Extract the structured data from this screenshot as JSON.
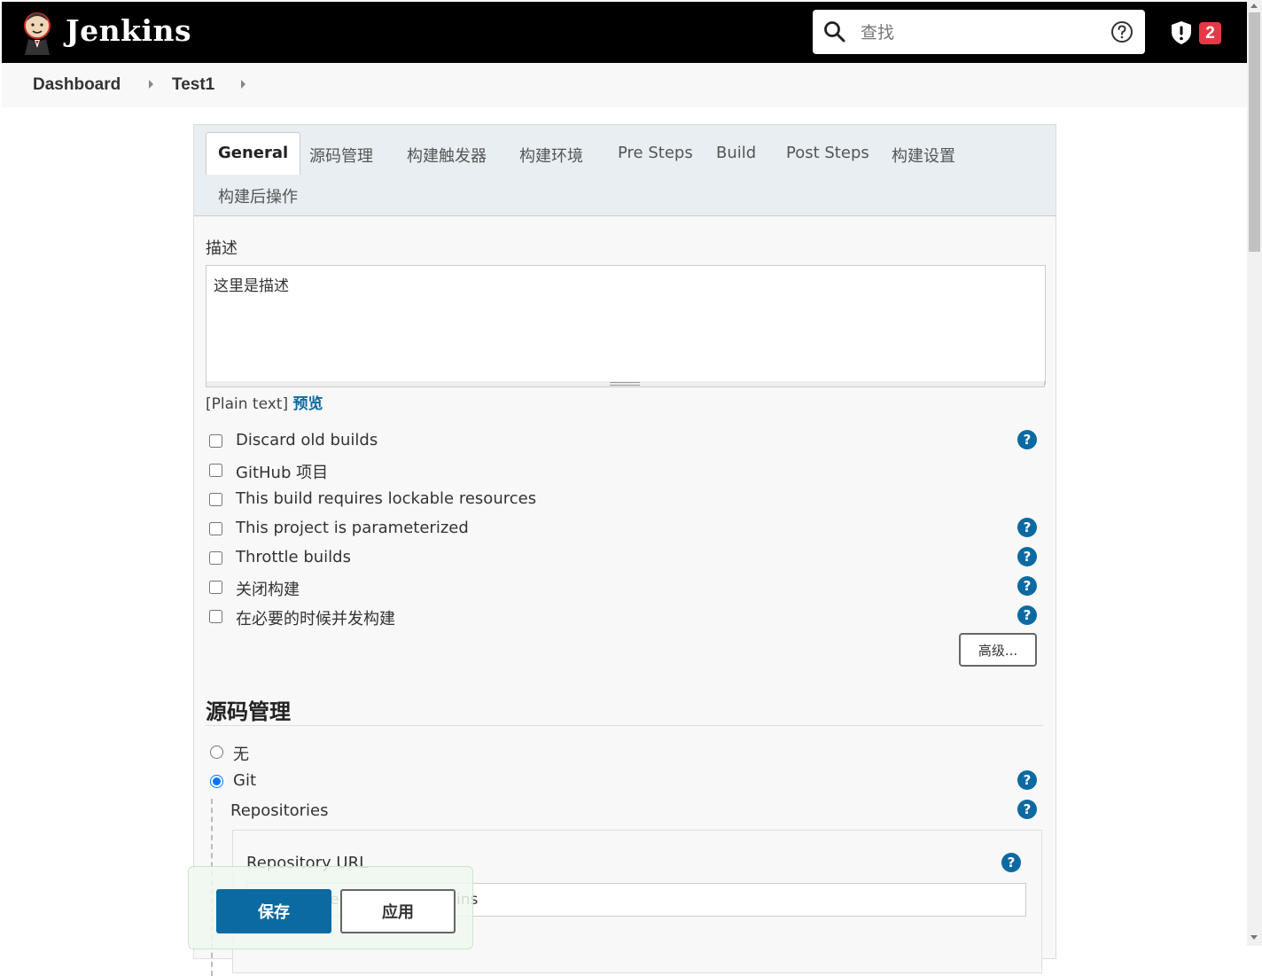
{
  "header": {
    "app_title": "Jenkins",
    "search_placeholder": "查找",
    "security_badge_count": "2",
    "icons": [
      "jenkins-logo-icon",
      "search-icon",
      "help-circle-icon",
      "shield-alert-icon"
    ]
  },
  "breadcrumb": {
    "items": [
      "Dashboard",
      "Test1"
    ]
  },
  "tabs": [
    "General",
    "源码管理",
    "构建触发器",
    "构建环境",
    "Pre Steps",
    "Build",
    "Post Steps",
    "构建设置",
    "构建后操作"
  ],
  "general": {
    "description_label": "描述",
    "description_value": "这里是描述",
    "plain_text": "[Plain text]",
    "preview_label": "预览",
    "options": [
      {
        "label": "Discard old builds",
        "checked": false,
        "has_help": true
      },
      {
        "label": "GitHub 项目",
        "checked": false,
        "has_help": false
      },
      {
        "label": "This build requires lockable resources",
        "checked": false,
        "has_help": false
      },
      {
        "label": "This project is parameterized",
        "checked": false,
        "has_help": true
      },
      {
        "label": "Throttle builds",
        "checked": false,
        "has_help": true
      },
      {
        "label": "关闭构建",
        "checked": false,
        "has_help": true
      },
      {
        "label": "在必要的时候并发构建",
        "checked": false,
        "has_help": true
      }
    ],
    "advanced_label": "高级..."
  },
  "scm": {
    "title": "源码管理",
    "options": [
      {
        "label": "无",
        "selected": false
      },
      {
        "label": "Git",
        "selected": true
      }
    ],
    "repositories_label": "Repositories",
    "repository_url_label": "Repository URL",
    "repository_url_value": "https://gitee.com/test-jenkins"
  },
  "actions": {
    "save_label": "保存",
    "apply_label": "应用"
  }
}
